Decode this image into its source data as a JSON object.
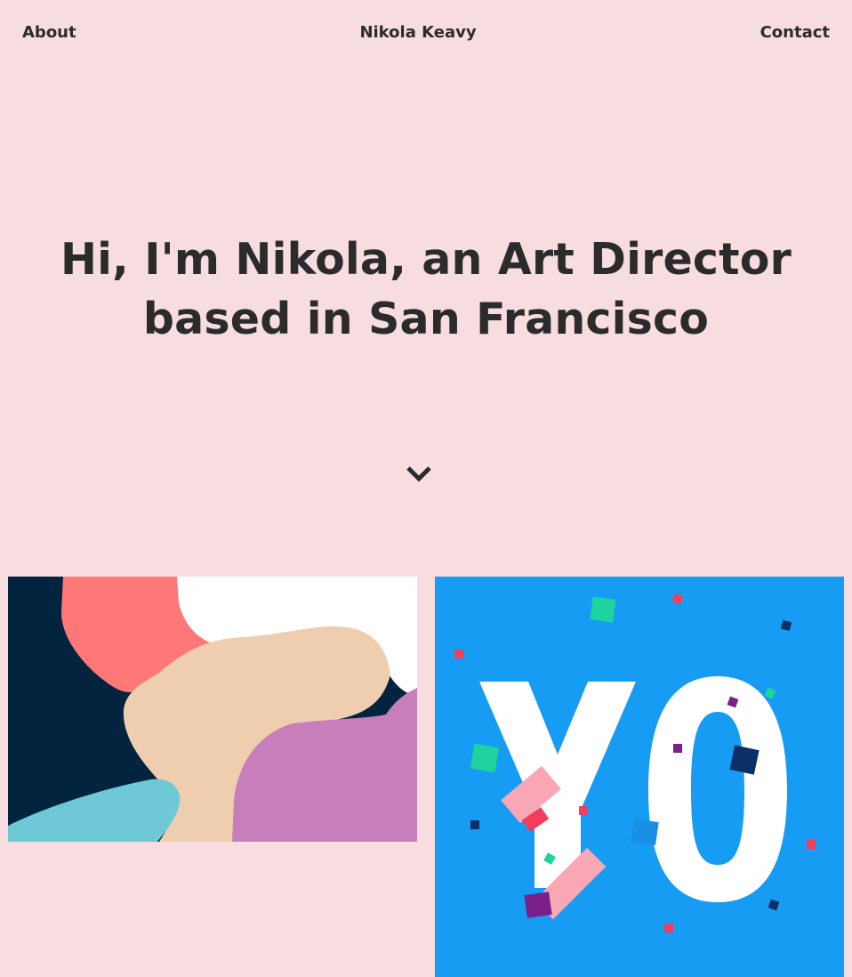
{
  "nav": {
    "about_label": "About",
    "brand_label": "Nikola Keavy",
    "contact_label": "Contact"
  },
  "hero": {
    "line1": "Hi, I'm Nikola, an Art Director",
    "line2": "based in San Francisco"
  },
  "scroll": {
    "icon": "chevron-down-icon"
  },
  "projects": [
    {
      "name": "abstract-blobs-artwork",
      "colors": [
        "#02243e",
        "#ff7878",
        "#ffffff",
        "#efceb0",
        "#c97ebc",
        "#6fc8d6"
      ]
    },
    {
      "name": "yo-confetti-artwork",
      "text": "YO",
      "colors": [
        "#169cf2",
        "#ffffff",
        "#f9a6b5",
        "#f23d5d",
        "#1fd39e",
        "#0b2f66",
        "#7b1f8a"
      ]
    }
  ],
  "colors": {
    "background": "#f8dde0",
    "text": "#2b2b2b"
  }
}
